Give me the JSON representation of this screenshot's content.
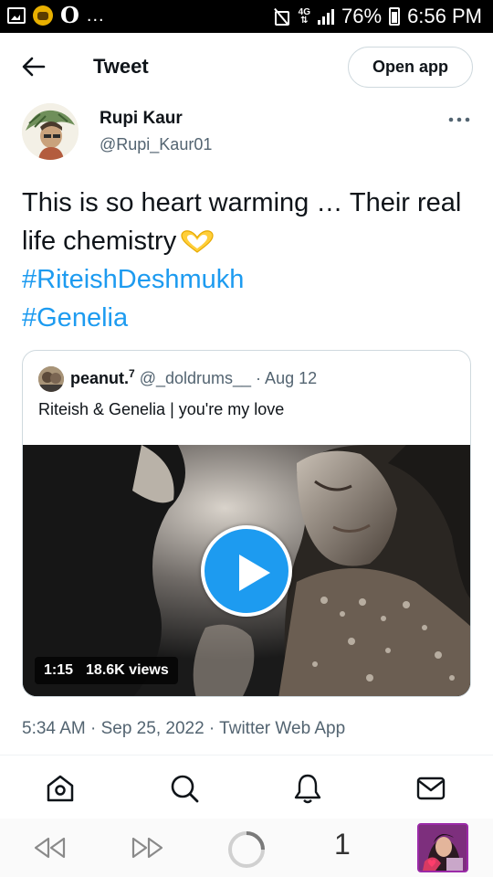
{
  "status_bar": {
    "left_dots": "...",
    "left_letter": "O",
    "network": "4G",
    "battery": "76%",
    "time": "6:56 PM"
  },
  "header": {
    "title": "Tweet",
    "open_app_label": "Open app"
  },
  "author": {
    "name": "Rupi Kaur",
    "handle": "@Rupi_Kaur01"
  },
  "tweet": {
    "text": "This is so heart warming … Their real life chemistry",
    "emoji_icon": "heart-hands-icon",
    "hashtags": [
      "#RiteishDeshmukh",
      "#Genelia"
    ],
    "timestamp": "5:34 AM · Sep 25, 2022 · Twitter Web App"
  },
  "quoted": {
    "name": "peanut.",
    "name_sup": "7",
    "meta": "@_doldrums__ · Aug 12",
    "text": "Riteish & Genelia | you're my love",
    "duration": "1:15",
    "views": "18.6K views"
  },
  "nav": {
    "icons": [
      "home-icon",
      "search-icon",
      "notifications-icon",
      "messages-icon"
    ]
  },
  "browser": {
    "tab_count": "1"
  },
  "colors": {
    "accent": "#1d9bf0",
    "secondary_text": "#536471",
    "primary_text": "#0f1419",
    "border": "#cfd9de"
  }
}
